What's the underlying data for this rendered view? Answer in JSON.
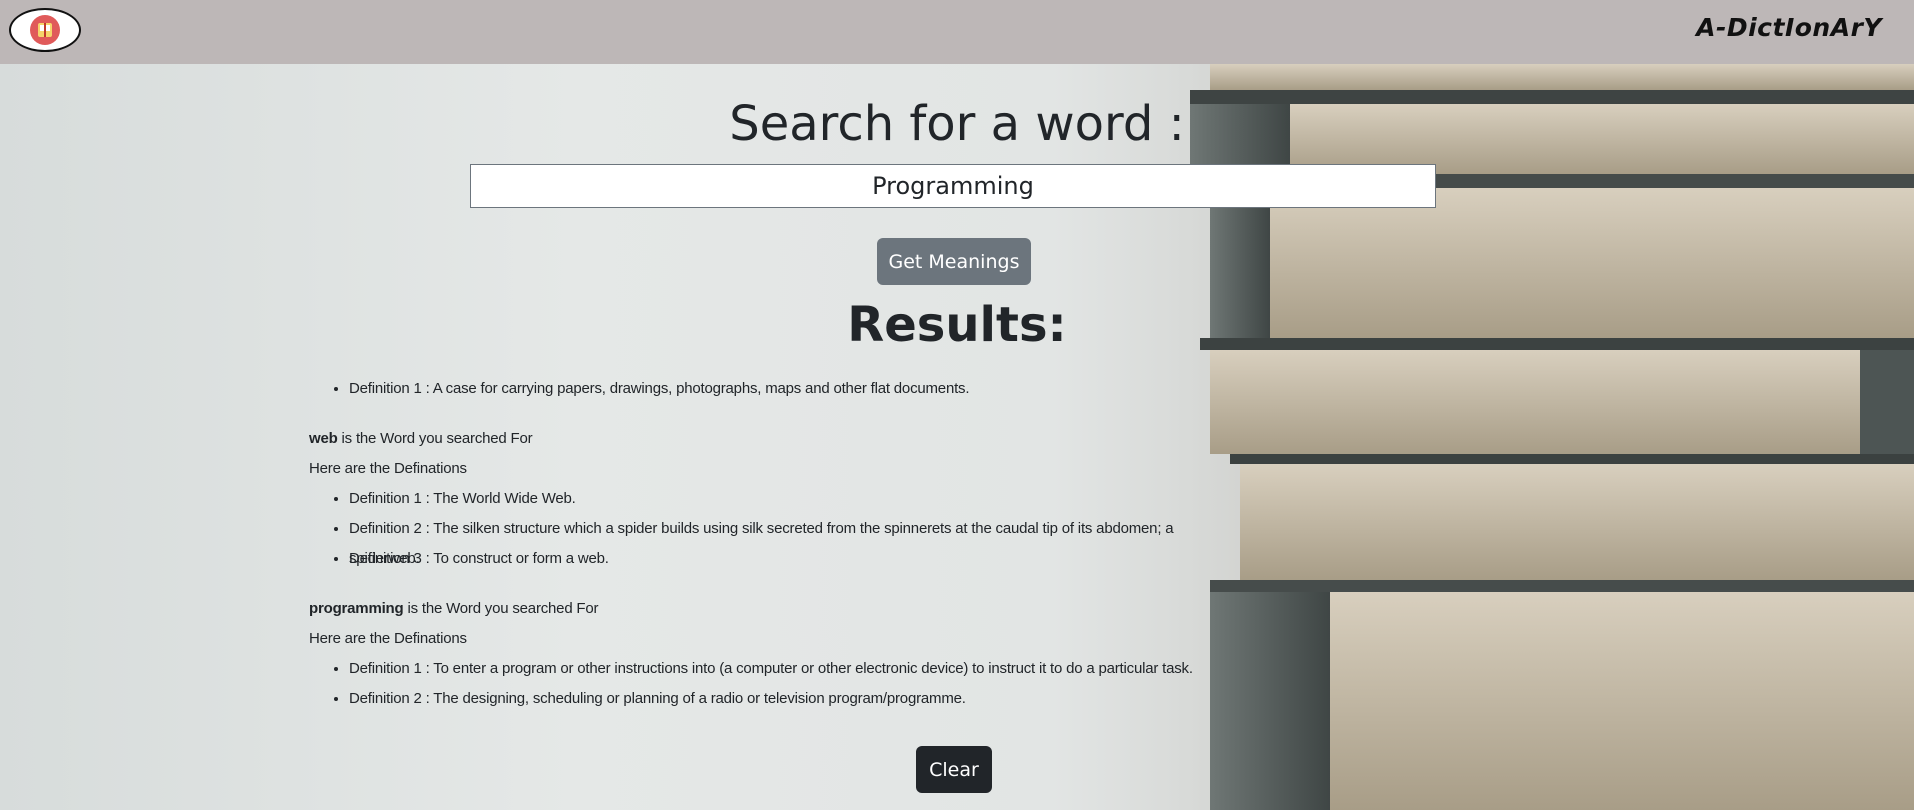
{
  "navbar": {
    "logo_icon": "book-icon",
    "brand": "A-DictIonArY"
  },
  "search": {
    "heading": "Search for a word :",
    "input_value": "Programming",
    "button_label": "Get Meanings"
  },
  "results": {
    "heading": "Results:",
    "orphan_definitions": [
      "Definition 1 : A case for carrying papers, drawings, photographs, maps and other flat documents."
    ],
    "entries": [
      {
        "word": "web",
        "suffix": " is the Word you searched For",
        "intro": "Here are the Definations",
        "definitions": [
          "Definition 1 : The World Wide Web.",
          "Definition 2 : The silken structure which a spider builds using silk secreted from the spinnerets at the caudal tip of its abdomen; a spiderweb.",
          "Definition 3 : To construct or form a web."
        ]
      },
      {
        "word": "programming",
        "suffix": " is the Word you searched For",
        "intro": "Here are the Definations",
        "definitions": [
          "Definition 1 : To enter a program or other instructions into (a computer or other electronic device) to instruct it to do a particular task.",
          "Definition 2 : The designing, scheduling or planning of a radio or television program/programme."
        ]
      }
    ],
    "clear_label": "Clear"
  },
  "colors": {
    "navbar": "#bdb7b7",
    "primary_button": "#6c757d",
    "dark_button": "#212529"
  }
}
